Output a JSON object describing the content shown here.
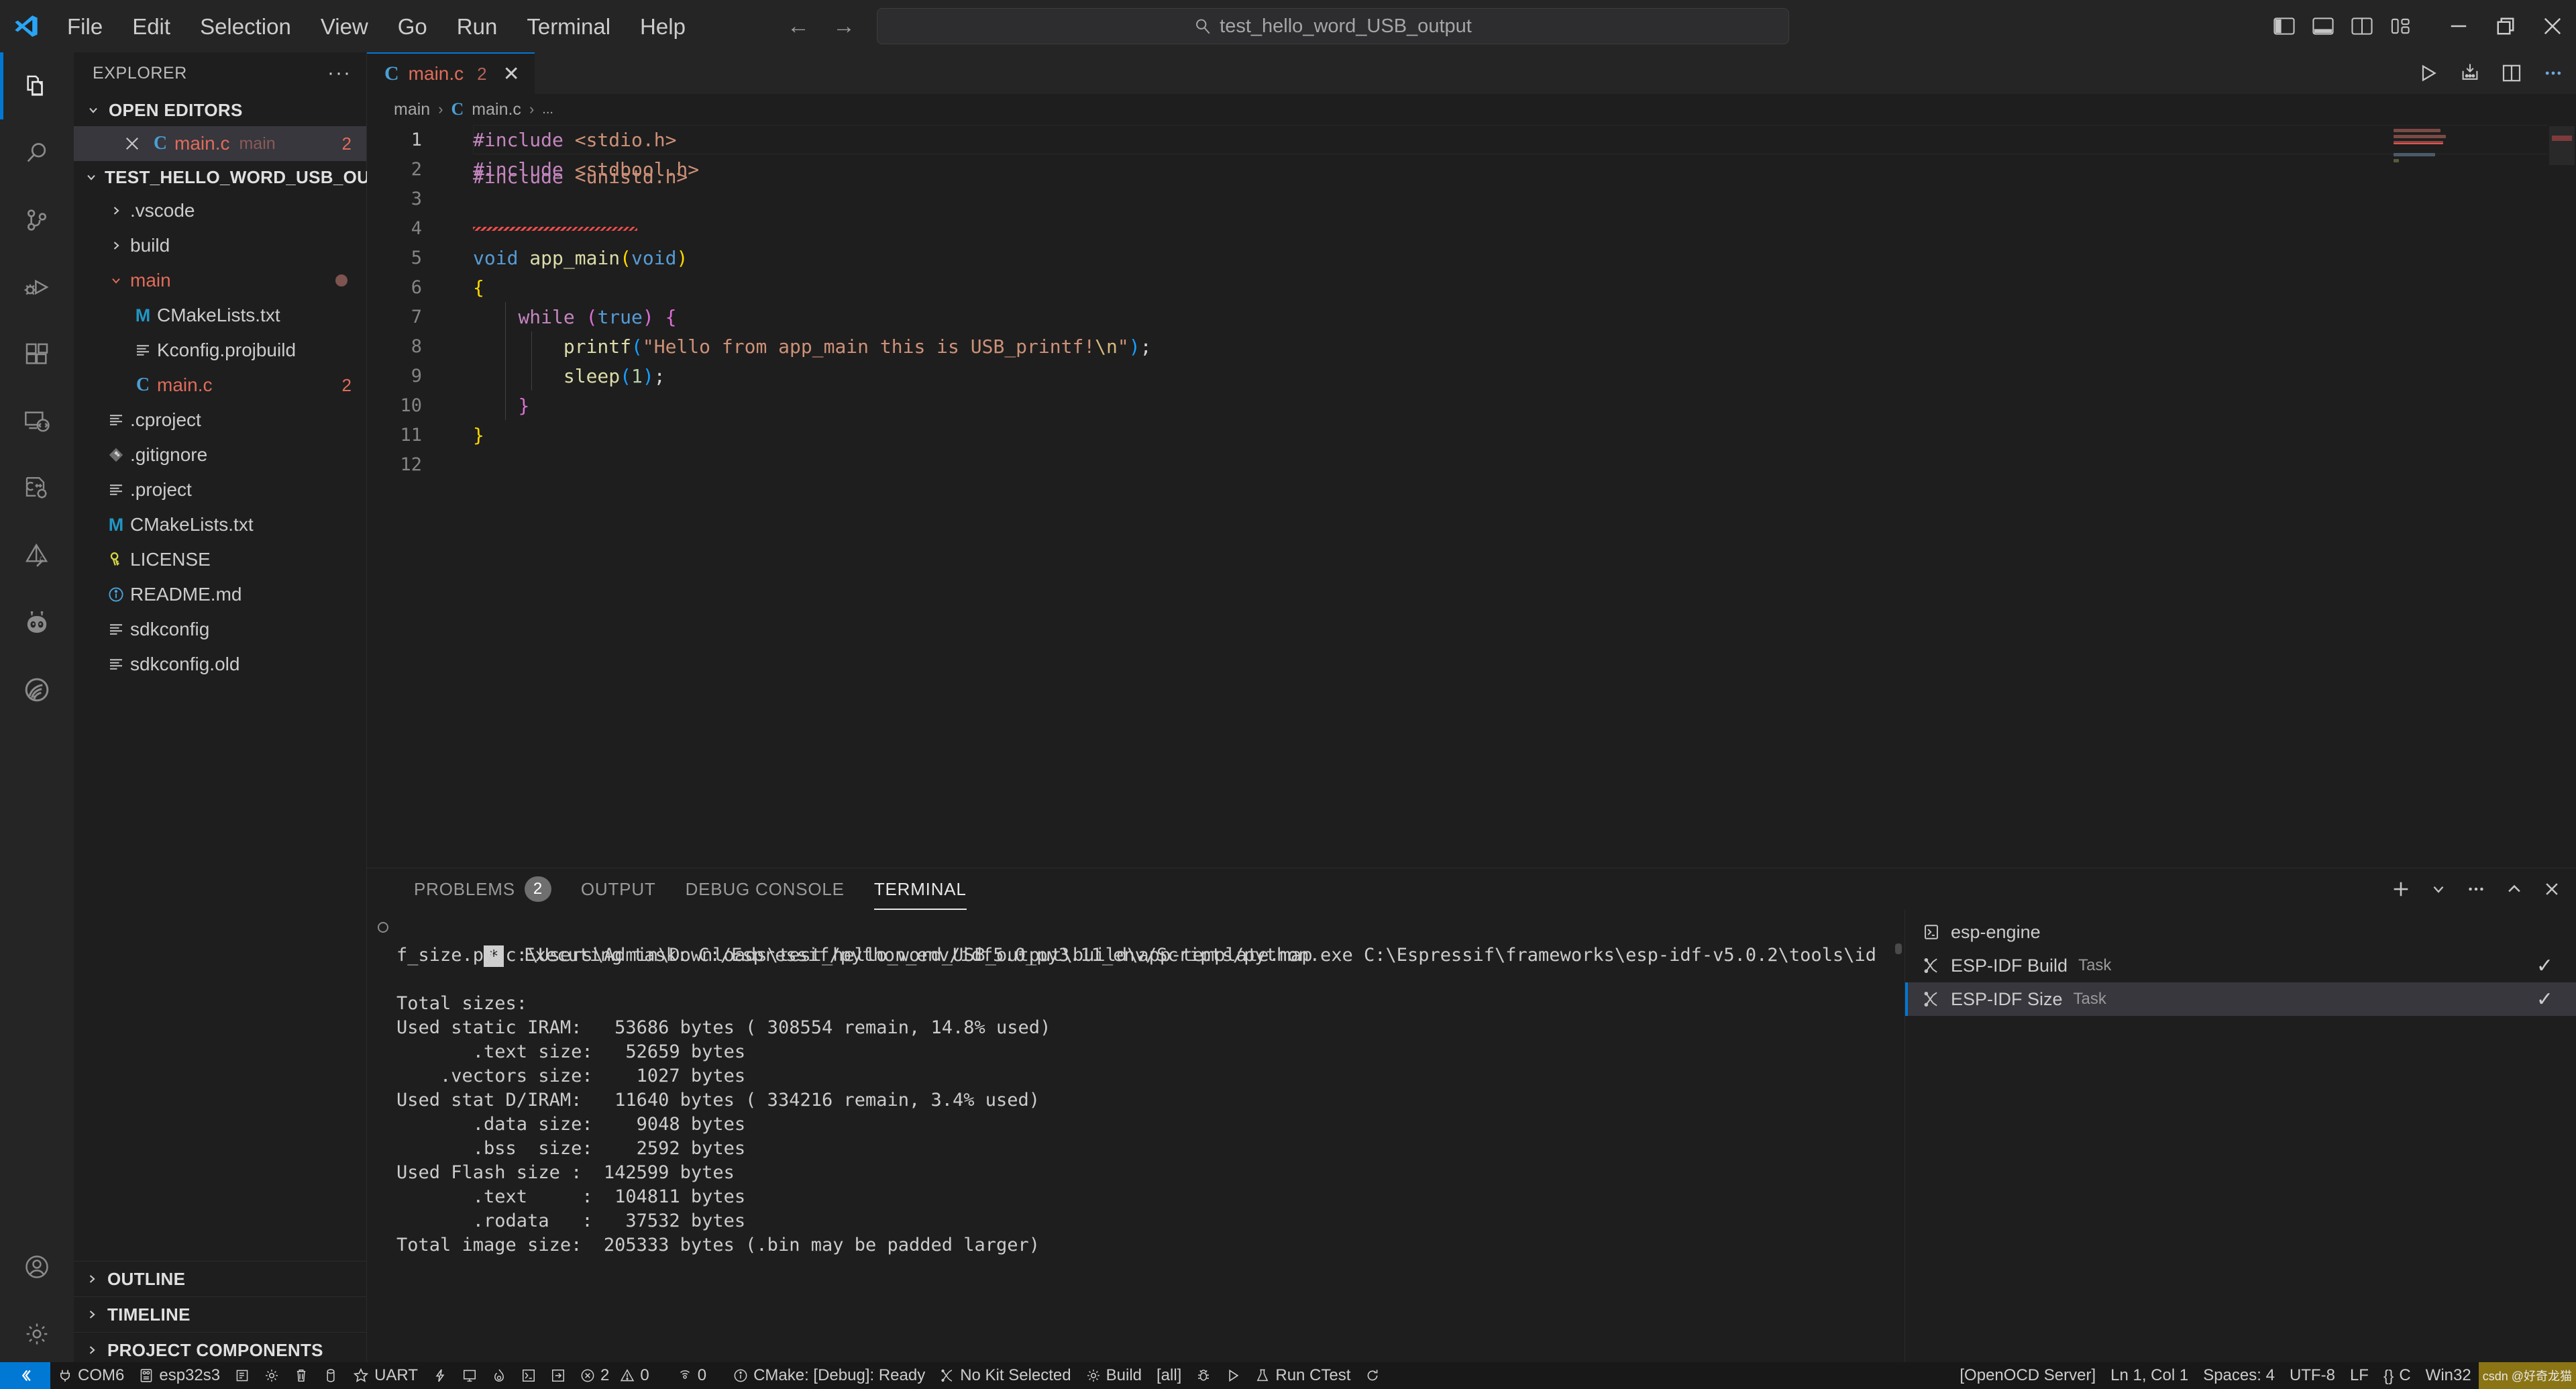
{
  "titlebar": {
    "menu": [
      "File",
      "Edit",
      "Selection",
      "View",
      "Go",
      "Run",
      "Terminal",
      "Help"
    ],
    "quick_open_value": "test_hello_word_USB_output",
    "back_label": "←",
    "forward_label": "→",
    "layout_buttons": [
      "toggle-primary-sidebar",
      "toggle-panel",
      "toggle-secondary-sidebar",
      "customize-layout"
    ],
    "window_buttons": [
      "minimize",
      "restore",
      "close"
    ]
  },
  "activitybar": {
    "items": [
      {
        "name": "explorer",
        "active": true
      },
      {
        "name": "search",
        "active": false
      },
      {
        "name": "source-control",
        "active": false
      },
      {
        "name": "run-and-debug",
        "active": false
      },
      {
        "name": "extensions",
        "active": false
      },
      {
        "name": "remote-explorer",
        "active": false
      },
      {
        "name": "cmake-tools",
        "active": false
      },
      {
        "name": "esp-idf-wokwi",
        "active": false
      },
      {
        "name": "platformio",
        "active": false
      },
      {
        "name": "espressif-idf",
        "active": false
      }
    ],
    "bottom": [
      {
        "name": "accounts",
        "active": false
      },
      {
        "name": "manage-settings",
        "active": false
      }
    ]
  },
  "sidebar": {
    "title": "EXPLORER",
    "more_actions": "···",
    "open_editors": {
      "label": "OPEN EDITORS",
      "expanded": true,
      "items": [
        {
          "name": "main.c",
          "folder": "main",
          "icon": "c-file-icon",
          "badge": "2",
          "selected": true
        }
      ]
    },
    "workspace": {
      "label": "TEST_HELLO_WORD_USB_OUT...",
      "expanded": true,
      "items": [
        {
          "name": ".vscode",
          "type": "folder",
          "expanded": false,
          "indent": 1,
          "icon": "chevron-right-icon",
          "badge": "",
          "modified": false
        },
        {
          "name": "build",
          "type": "folder",
          "expanded": false,
          "indent": 1,
          "icon": "chevron-right-icon",
          "badge": "",
          "modified": false
        },
        {
          "name": "main",
          "type": "folder",
          "expanded": true,
          "indent": 1,
          "icon": "chevron-down-icon",
          "badge": "",
          "modified": true,
          "color": "red"
        },
        {
          "name": "CMakeLists.txt",
          "type": "file",
          "indent": 2,
          "icon": "cmake-icon",
          "badge": "",
          "modified": false
        },
        {
          "name": "Kconfig.projbuild",
          "type": "file",
          "indent": 2,
          "icon": "text-file-icon",
          "badge": "",
          "modified": false
        },
        {
          "name": "main.c",
          "type": "file",
          "indent": 2,
          "icon": "c-file-icon",
          "badge": "2",
          "modified": false,
          "color": "red"
        },
        {
          "name": ".cproject",
          "type": "file",
          "indent": 1,
          "icon": "text-file-icon",
          "badge": "",
          "modified": false
        },
        {
          "name": ".gitignore",
          "type": "file",
          "indent": 1,
          "icon": "git-icon",
          "badge": "",
          "modified": false
        },
        {
          "name": ".project",
          "type": "file",
          "indent": 1,
          "icon": "text-file-icon",
          "badge": "",
          "modified": false
        },
        {
          "name": "CMakeLists.txt",
          "type": "file",
          "indent": 1,
          "icon": "cmake-icon",
          "badge": "",
          "modified": false
        },
        {
          "name": "LICENSE",
          "type": "file",
          "indent": 1,
          "icon": "key-icon",
          "badge": "",
          "modified": false
        },
        {
          "name": "README.md",
          "type": "file",
          "indent": 1,
          "icon": "info-icon",
          "badge": "",
          "modified": false
        },
        {
          "name": "sdkconfig",
          "type": "file",
          "indent": 1,
          "icon": "text-file-icon",
          "badge": "",
          "modified": false
        },
        {
          "name": "sdkconfig.old",
          "type": "file",
          "indent": 1,
          "icon": "text-file-icon",
          "badge": "",
          "modified": false
        }
      ]
    },
    "collapsed_sections": [
      "OUTLINE",
      "TIMELINE",
      "PROJECT COMPONENTS"
    ]
  },
  "editor": {
    "tabs": [
      {
        "label": "main.c",
        "icon": "c-file-icon",
        "badge": "2",
        "active": true,
        "close": "✕"
      }
    ],
    "actions": [
      "run-button",
      "run-debug-button",
      "split-editor-button",
      "more-actions-button"
    ],
    "breadcrumb": [
      "main",
      "main.c",
      "..."
    ],
    "breadcrumb_icon": "c-file-icon",
    "cursor_line": 1,
    "lines": [
      {
        "n": "1",
        "text": "#include <stdio.h>"
      },
      {
        "n": "2",
        "text": "#include <stdbool.h>"
      },
      {
        "n": "3",
        "text": "#include <unistd.h>"
      },
      {
        "n": "4",
        "text": ""
      },
      {
        "n": "5",
        "text": "void app_main(void)"
      },
      {
        "n": "6",
        "text": "{"
      },
      {
        "n": "7",
        "text": "    while (true) {"
      },
      {
        "n": "8",
        "text": "        printf(\"Hello from app_main this is USB_printf!\\n\");"
      },
      {
        "n": "9",
        "text": "        sleep(1);"
      },
      {
        "n": "10",
        "text": "    }"
      },
      {
        "n": "11",
        "text": "}"
      },
      {
        "n": "12",
        "text": ""
      }
    ]
  },
  "panel": {
    "tabs": [
      {
        "label": "PROBLEMS",
        "badge": "2",
        "active": false
      },
      {
        "label": "OUTPUT",
        "badge": "",
        "active": false
      },
      {
        "label": "DEBUG CONSOLE",
        "badge": "",
        "active": false
      },
      {
        "label": "TERMINAL",
        "badge": "",
        "active": true
      }
    ],
    "actions": [
      "new-terminal-button",
      "terminal-dropdown-button",
      "more-actions-button",
      "maximize-panel-button",
      "close-panel-button"
    ],
    "terminal_marker": "*",
    "terminal_lines": [
      " Executing task: C:/Espressif/python_env/idf5.0_py3.11_env/Scripts/python.exe C:\\Espressif\\frameworks\\esp-idf-v5.0.2\\tools\\id",
      "f_size.py c:\\Users\\Admin\\Downloads\\test_hello_word_USB_output\\build\\app-template.map",
      "",
      "Total sizes:",
      "Used static IRAM:   53686 bytes ( 308554 remain, 14.8% used)",
      "       .text size:   52659 bytes",
      "    .vectors size:    1027 bytes",
      "Used stat D/IRAM:   11640 bytes ( 334216 remain, 3.4% used)",
      "       .data size:    9048 bytes",
      "       .bss  size:    2592 bytes",
      "Used Flash size :  142599 bytes",
      "       .text     :  104811 bytes",
      "       .rodata   :   37532 bytes",
      "Total image size:  205333 bytes (.bin may be padded larger)"
    ],
    "terminal_list": [
      {
        "label": "esp-engine",
        "kind": "",
        "icon": "terminal-icon",
        "selected": false,
        "check": ""
      },
      {
        "label": "ESP-IDF Build",
        "kind": "Task",
        "icon": "tools-icon",
        "selected": false,
        "check": "✓"
      },
      {
        "label": "ESP-IDF Size",
        "kind": "Task",
        "icon": "tools-icon",
        "selected": true,
        "check": "✓"
      }
    ]
  },
  "statusbar": {
    "left": [
      {
        "name": "remote-indicator",
        "icon": "remote-icon",
        "label": "",
        "accent": "#0078d4"
      },
      {
        "name": "serial-port",
        "icon": "plug-icon",
        "label": "COM6"
      },
      {
        "name": "target-chip",
        "icon": "chip-icon",
        "label": "esp32s3"
      },
      {
        "name": "select-flash-method",
        "icon": "folder-gear-icon",
        "label": ""
      },
      {
        "name": "menuconfig",
        "icon": "gear-icon",
        "label": ""
      },
      {
        "name": "full-clean",
        "icon": "trash-icon",
        "label": ""
      },
      {
        "name": "build-project",
        "icon": "cylinder-icon",
        "label": ""
      },
      {
        "name": "flash-device",
        "icon": "star-icon",
        "label": "UART"
      },
      {
        "name": "monitor-device",
        "icon": "bolt-icon",
        "label": ""
      },
      {
        "name": "open-monitor",
        "icon": "monitor-icon",
        "label": ""
      },
      {
        "name": "debug-flame",
        "icon": "flame-icon",
        "label": ""
      },
      {
        "name": "open-terminal",
        "icon": "terminal-icon",
        "label": ""
      },
      {
        "name": "idf-open",
        "icon": "enter-icon",
        "label": ""
      },
      {
        "name": "problems-errors",
        "icon": "error-icon",
        "label": "2"
      },
      {
        "name": "problems-warnings",
        "icon": "warning-icon",
        "label": "0"
      },
      {
        "name": "ports-forwarded",
        "icon": "radio-icon",
        "label": "0"
      },
      {
        "name": "cmake-status",
        "icon": "info-icon",
        "label": "CMake: [Debug]: Ready"
      },
      {
        "name": "cmake-kit",
        "icon": "tools-icon",
        "label": "No Kit Selected"
      },
      {
        "name": "cmake-build",
        "icon": "gear-icon",
        "label": "Build"
      },
      {
        "name": "cmake-target",
        "icon": "",
        "label": "[all]"
      },
      {
        "name": "cmake-debug",
        "icon": "bug-icon",
        "label": ""
      },
      {
        "name": "cmake-launch",
        "icon": "play-icon",
        "label": ""
      },
      {
        "name": "run-ctest",
        "icon": "flask-icon",
        "label": "Run CTest"
      },
      {
        "name": "cmake-refresh",
        "icon": "refresh-icon",
        "label": ""
      }
    ],
    "right": [
      {
        "name": "openocd-server",
        "label": "[OpenOCD Server]"
      },
      {
        "name": "editor-position",
        "label": "Ln 1, Col 1"
      },
      {
        "name": "indentation",
        "label": "Spaces: 4"
      },
      {
        "name": "encoding",
        "label": "UTF-8"
      },
      {
        "name": "eol",
        "label": "LF"
      },
      {
        "name": "language-mode",
        "label": "C",
        "icon": "braces-icon"
      },
      {
        "name": "platform",
        "label": "Win32"
      }
    ],
    "watermark": "csdn @好奇龙猫"
  },
  "colors": {
    "accent": "#0078d4",
    "titlebar_bg": "#252526",
    "editor_bg": "#1e1e1e",
    "statusbar_bg": "#181818",
    "selection_bg": "#37373d",
    "error": "#f14c4c",
    "file_red": "#e06c5a"
  }
}
